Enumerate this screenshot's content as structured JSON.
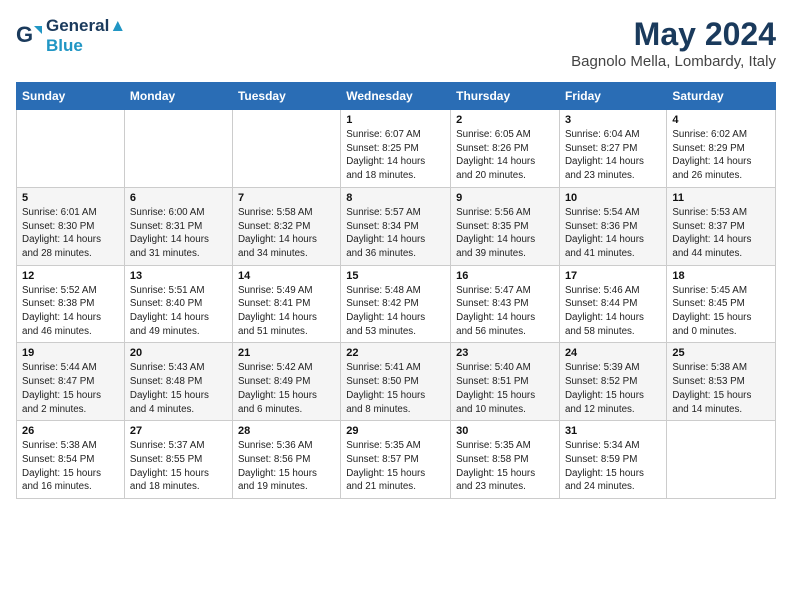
{
  "logo": {
    "line1": "General",
    "line2": "Blue"
  },
  "title": "May 2024",
  "location": "Bagnolo Mella, Lombardy, Italy",
  "days_of_week": [
    "Sunday",
    "Monday",
    "Tuesday",
    "Wednesday",
    "Thursday",
    "Friday",
    "Saturday"
  ],
  "weeks": [
    [
      {
        "num": "",
        "info": ""
      },
      {
        "num": "",
        "info": ""
      },
      {
        "num": "",
        "info": ""
      },
      {
        "num": "1",
        "info": "Sunrise: 6:07 AM\nSunset: 8:25 PM\nDaylight: 14 hours\nand 18 minutes."
      },
      {
        "num": "2",
        "info": "Sunrise: 6:05 AM\nSunset: 8:26 PM\nDaylight: 14 hours\nand 20 minutes."
      },
      {
        "num": "3",
        "info": "Sunrise: 6:04 AM\nSunset: 8:27 PM\nDaylight: 14 hours\nand 23 minutes."
      },
      {
        "num": "4",
        "info": "Sunrise: 6:02 AM\nSunset: 8:29 PM\nDaylight: 14 hours\nand 26 minutes."
      }
    ],
    [
      {
        "num": "5",
        "info": "Sunrise: 6:01 AM\nSunset: 8:30 PM\nDaylight: 14 hours\nand 28 minutes."
      },
      {
        "num": "6",
        "info": "Sunrise: 6:00 AM\nSunset: 8:31 PM\nDaylight: 14 hours\nand 31 minutes."
      },
      {
        "num": "7",
        "info": "Sunrise: 5:58 AM\nSunset: 8:32 PM\nDaylight: 14 hours\nand 34 minutes."
      },
      {
        "num": "8",
        "info": "Sunrise: 5:57 AM\nSunset: 8:34 PM\nDaylight: 14 hours\nand 36 minutes."
      },
      {
        "num": "9",
        "info": "Sunrise: 5:56 AM\nSunset: 8:35 PM\nDaylight: 14 hours\nand 39 minutes."
      },
      {
        "num": "10",
        "info": "Sunrise: 5:54 AM\nSunset: 8:36 PM\nDaylight: 14 hours\nand 41 minutes."
      },
      {
        "num": "11",
        "info": "Sunrise: 5:53 AM\nSunset: 8:37 PM\nDaylight: 14 hours\nand 44 minutes."
      }
    ],
    [
      {
        "num": "12",
        "info": "Sunrise: 5:52 AM\nSunset: 8:38 PM\nDaylight: 14 hours\nand 46 minutes."
      },
      {
        "num": "13",
        "info": "Sunrise: 5:51 AM\nSunset: 8:40 PM\nDaylight: 14 hours\nand 49 minutes."
      },
      {
        "num": "14",
        "info": "Sunrise: 5:49 AM\nSunset: 8:41 PM\nDaylight: 14 hours\nand 51 minutes."
      },
      {
        "num": "15",
        "info": "Sunrise: 5:48 AM\nSunset: 8:42 PM\nDaylight: 14 hours\nand 53 minutes."
      },
      {
        "num": "16",
        "info": "Sunrise: 5:47 AM\nSunset: 8:43 PM\nDaylight: 14 hours\nand 56 minutes."
      },
      {
        "num": "17",
        "info": "Sunrise: 5:46 AM\nSunset: 8:44 PM\nDaylight: 14 hours\nand 58 minutes."
      },
      {
        "num": "18",
        "info": "Sunrise: 5:45 AM\nSunset: 8:45 PM\nDaylight: 15 hours\nand 0 minutes."
      }
    ],
    [
      {
        "num": "19",
        "info": "Sunrise: 5:44 AM\nSunset: 8:47 PM\nDaylight: 15 hours\nand 2 minutes."
      },
      {
        "num": "20",
        "info": "Sunrise: 5:43 AM\nSunset: 8:48 PM\nDaylight: 15 hours\nand 4 minutes."
      },
      {
        "num": "21",
        "info": "Sunrise: 5:42 AM\nSunset: 8:49 PM\nDaylight: 15 hours\nand 6 minutes."
      },
      {
        "num": "22",
        "info": "Sunrise: 5:41 AM\nSunset: 8:50 PM\nDaylight: 15 hours\nand 8 minutes."
      },
      {
        "num": "23",
        "info": "Sunrise: 5:40 AM\nSunset: 8:51 PM\nDaylight: 15 hours\nand 10 minutes."
      },
      {
        "num": "24",
        "info": "Sunrise: 5:39 AM\nSunset: 8:52 PM\nDaylight: 15 hours\nand 12 minutes."
      },
      {
        "num": "25",
        "info": "Sunrise: 5:38 AM\nSunset: 8:53 PM\nDaylight: 15 hours\nand 14 minutes."
      }
    ],
    [
      {
        "num": "26",
        "info": "Sunrise: 5:38 AM\nSunset: 8:54 PM\nDaylight: 15 hours\nand 16 minutes."
      },
      {
        "num": "27",
        "info": "Sunrise: 5:37 AM\nSunset: 8:55 PM\nDaylight: 15 hours\nand 18 minutes."
      },
      {
        "num": "28",
        "info": "Sunrise: 5:36 AM\nSunset: 8:56 PM\nDaylight: 15 hours\nand 19 minutes."
      },
      {
        "num": "29",
        "info": "Sunrise: 5:35 AM\nSunset: 8:57 PM\nDaylight: 15 hours\nand 21 minutes."
      },
      {
        "num": "30",
        "info": "Sunrise: 5:35 AM\nSunset: 8:58 PM\nDaylight: 15 hours\nand 23 minutes."
      },
      {
        "num": "31",
        "info": "Sunrise: 5:34 AM\nSunset: 8:59 PM\nDaylight: 15 hours\nand 24 minutes."
      },
      {
        "num": "",
        "info": ""
      }
    ]
  ]
}
